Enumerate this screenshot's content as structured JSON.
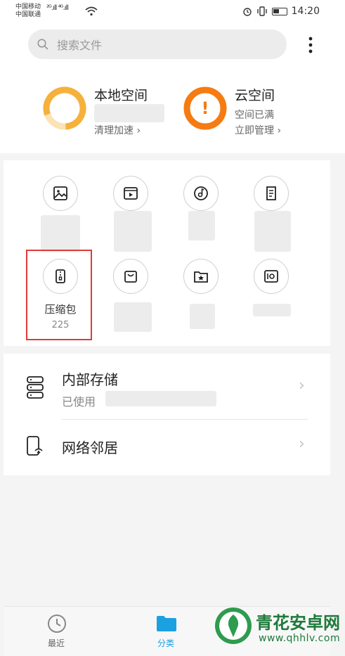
{
  "status_bar": {
    "carrier1": "中国移动",
    "carrier2": "中国联通",
    "signal": "²ᴳ.ıll ⁴ᴳ.ıll",
    "time": "14:20"
  },
  "search": {
    "placeholder": "搜索文件"
  },
  "local_space": {
    "title": "本地空间",
    "action": "清理加速 ›"
  },
  "cloud_space": {
    "title": "云空间",
    "status": "空间已满",
    "action": "立即管理 ›",
    "alert": "!"
  },
  "categories": [
    {
      "icon": "image-icon"
    },
    {
      "icon": "video-icon"
    },
    {
      "icon": "music-icon"
    },
    {
      "icon": "document-icon"
    },
    {
      "icon": "zip-icon",
      "label": "压缩包",
      "count": "225"
    },
    {
      "icon": "shopping-bag-icon"
    },
    {
      "icon": "favorites-icon"
    },
    {
      "icon": "safe-icon"
    }
  ],
  "storage": {
    "internal_title": "内部存储",
    "internal_sub": "已使用",
    "network_title": "网络邻居"
  },
  "nav": {
    "recent": "最近",
    "category": "分类"
  },
  "watermark": {
    "name": "青花安卓网",
    "url": "www.qhhlv.com"
  },
  "colors": {
    "accent": "#1ba0e1",
    "local_ring": "#f5b13c",
    "cloud_ring": "#f57b12",
    "highlight": "#e03a3a"
  }
}
